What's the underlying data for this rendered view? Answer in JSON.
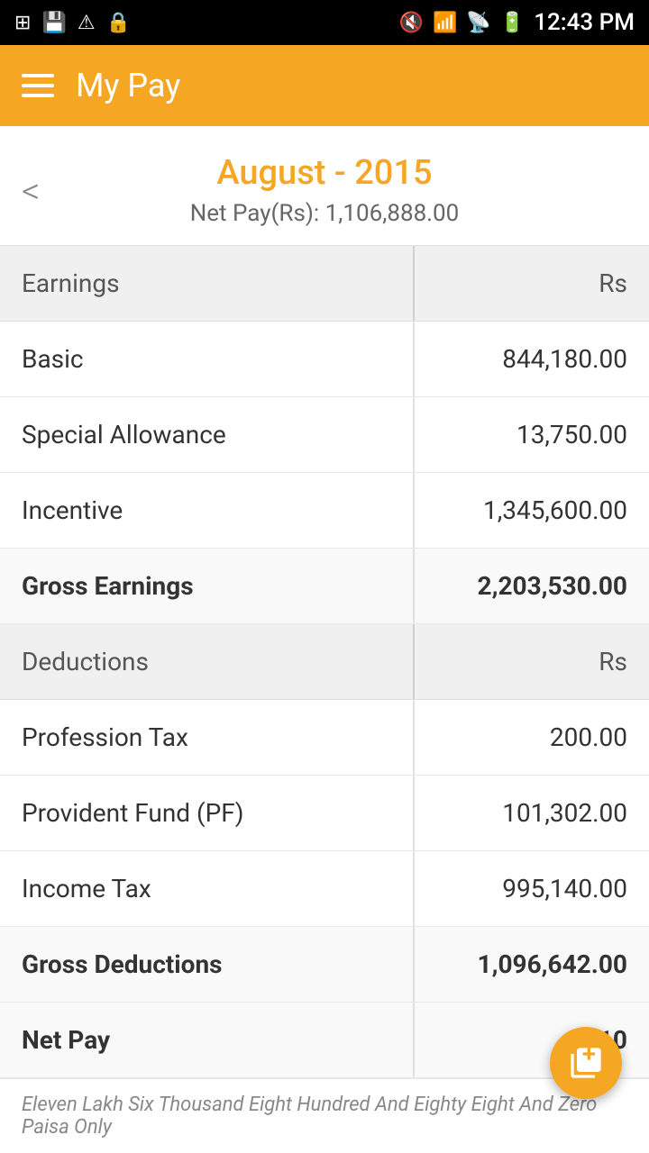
{
  "statusBar": {
    "time": "12:43 PM",
    "icons": [
      "gallery",
      "save",
      "warning",
      "lock",
      "mute",
      "wifi",
      "signal",
      "battery"
    ]
  },
  "appBar": {
    "title": "My Pay"
  },
  "monthHeader": {
    "month": "August - 2015",
    "netPayLabel": "Net Pay(Rs): 1,106,888.00"
  },
  "earningsSection": {
    "header": {
      "left": "Earnings",
      "right": "Rs"
    },
    "rows": [
      {
        "label": "Basic",
        "value": "844,180.00"
      },
      {
        "label": "Special Allowance",
        "value": "13,750.00"
      },
      {
        "label": "Incentive",
        "value": "1,345,600.00"
      }
    ],
    "grossRow": {
      "label": "Gross Earnings",
      "value": "2,203,530.00"
    }
  },
  "deductionsSection": {
    "header": {
      "left": "Deductions",
      "right": "Rs"
    },
    "rows": [
      {
        "label": "Profession Tax",
        "value": "200.00"
      },
      {
        "label": "Provident Fund (PF)",
        "value": "101,302.00"
      },
      {
        "label": "Income Tax",
        "value": "995,140.00"
      }
    ],
    "grossRow": {
      "label": "Gross Deductions",
      "value": "1,096,642.00"
    }
  },
  "netPayRow": {
    "label": "Net Pay",
    "value": "1,10"
  },
  "footerText": "Eleven Lakh Six Thousand Eight Hundred And Eighty Eight And Zero Paisa Only"
}
